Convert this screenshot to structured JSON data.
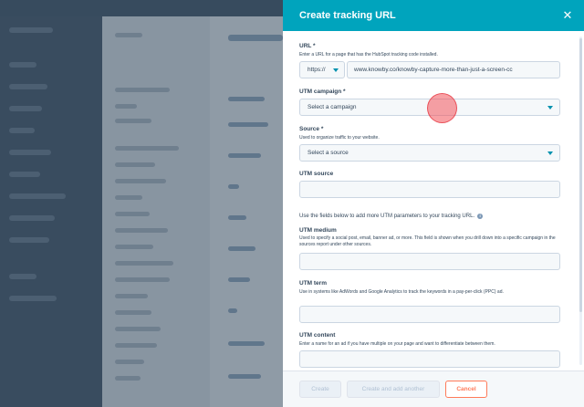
{
  "panel": {
    "title": "Create tracking URL",
    "close_icon": "close-icon"
  },
  "fields": {
    "url": {
      "label": "URL *",
      "help": "Enter a URL for a page that has the HubSpot tracking code installed.",
      "protocol": "https://",
      "value": "www.knowby.co/knowby-capture-more-than-just-a-screen-cc"
    },
    "utm_campaign": {
      "label": "UTM campaign *",
      "value": "Select a campaign"
    },
    "source": {
      "label": "Source *",
      "help": "Used to organize traffic to your website.",
      "value": "Select a source"
    },
    "utm_source": {
      "label": "UTM source",
      "value": ""
    },
    "info_text": "Use the fields below to add more UTM parameters to your tracking URL.",
    "utm_medium": {
      "label": "UTM medium",
      "help": "Used to specify a social post, email, banner ad, or more. This field is shown when you drill down into a specific campaign in the sources report under other sources.",
      "value": ""
    },
    "utm_term": {
      "label": "UTM term",
      "help": "Use in systems like AdWords and Google Analytics to track the keywords in a pay-per-click (PPC) ad.",
      "value": ""
    },
    "utm_content": {
      "label": "UTM content",
      "help": "Enter a name for an ad if you have multiple on your page and want to differentiate between them.",
      "value": ""
    }
  },
  "footer": {
    "create_label": "Create",
    "create_add_label": "Create and add another",
    "cancel_label": "Cancel"
  },
  "colors": {
    "header": "#00a4bd",
    "cancel": "#ff7a59",
    "caret": "#0091ae"
  }
}
